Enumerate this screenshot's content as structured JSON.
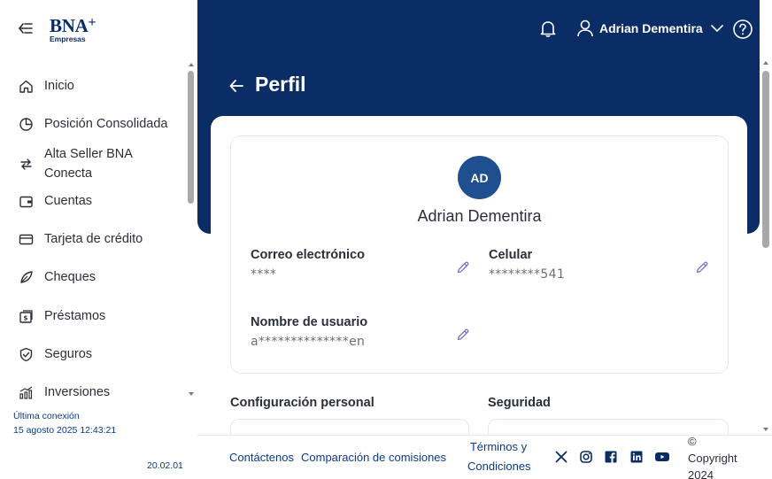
{
  "brand": {
    "name": "BNA",
    "plus": "+",
    "sub": "Empresas"
  },
  "sidebar": {
    "items": [
      {
        "label": "Inicio",
        "icon": "home-icon"
      },
      {
        "label": "Posición Consolidada",
        "icon": "pie-chart-icon"
      },
      {
        "label": "Alta Seller BNA Conecta",
        "icon": "transfer-arrows-icon"
      },
      {
        "label": "Cuentas",
        "icon": "wallet-icon"
      },
      {
        "label": "Tarjeta de crédito",
        "icon": "credit-card-icon"
      },
      {
        "label": "Cheques",
        "icon": "feather-icon"
      },
      {
        "label": "Préstamos",
        "icon": "loan-icon"
      },
      {
        "label": "Seguros",
        "icon": "shield-check-icon"
      },
      {
        "label": "Inversiones",
        "icon": "investments-chart-icon"
      }
    ],
    "last_connection_label": "Última conexión",
    "last_connection_value": "15 agosto 2025 12:43:21",
    "version": "20.02.01"
  },
  "header": {
    "user_name": "Adrian Dementira"
  },
  "page": {
    "title": "Perfil"
  },
  "profile": {
    "initials": "AD",
    "full_name": "Adrian Dementira",
    "fields": {
      "email_label": "Correo electrónico",
      "email_value": "****",
      "phone_label": "Celular",
      "phone_value": "********541",
      "username_label": "Nombre de usuario",
      "username_value": "a**************en"
    }
  },
  "sections": {
    "personal": "Configuración personal",
    "security": "Seguridad"
  },
  "footer": {
    "contact": "Contáctenos",
    "comparison": "Comparación de comisiones",
    "terms_line1": "Términos y",
    "terms_line2": "Condiciones",
    "copyright_symbol": "©",
    "copyright_word": "Copyright",
    "copyright_year": "2024"
  },
  "colors": {
    "primary": "#0b2d66",
    "avatar": "#1f4f8f",
    "link": "#0b3a8a",
    "edit_icon": "#7a73c4"
  }
}
